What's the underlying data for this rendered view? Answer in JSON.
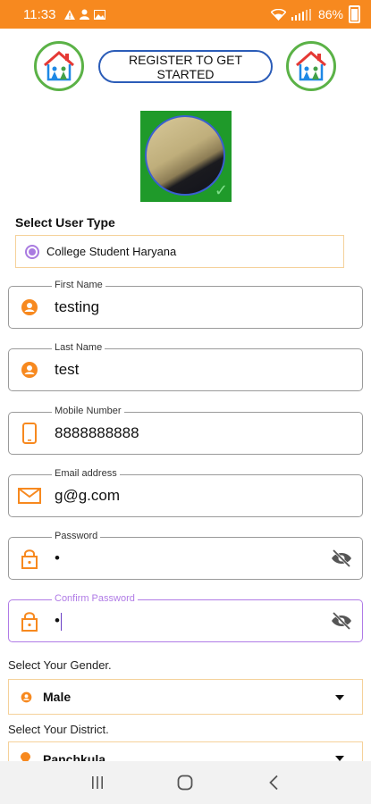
{
  "status_bar": {
    "time": "11:33",
    "battery": "86%",
    "notification_icons": [
      "warning-icon",
      "person-icon",
      "image-icon"
    ],
    "system_icons": [
      "wifi-icon",
      "signal-icon",
      "battery-icon"
    ]
  },
  "header": {
    "register_label": "REGISTER TO GET STARTED"
  },
  "user_type": {
    "section_label": "Select User Type",
    "selected_option": "College Student Haryana"
  },
  "fields": {
    "first_name": {
      "label": "First Name",
      "value": "testing"
    },
    "last_name": {
      "label": "Last Name",
      "value": "test"
    },
    "mobile": {
      "label": "Mobile Number",
      "value": "8888888888"
    },
    "email": {
      "label": "Email address",
      "value": "g@g.com"
    },
    "password": {
      "label": "Password",
      "value": "•"
    },
    "confirm_password": {
      "label": "Confirm Password",
      "value": "•"
    }
  },
  "gender": {
    "label": "Select Your Gender.",
    "value": "Male"
  },
  "district": {
    "label": "Select Your  District.",
    "value": "Panchkula"
  },
  "colors": {
    "accent": "#f7891f",
    "focus": "#b07be6",
    "select_border": "#f5d19a",
    "logo_green": "#5bb247",
    "button_border": "#2b5cb8"
  }
}
